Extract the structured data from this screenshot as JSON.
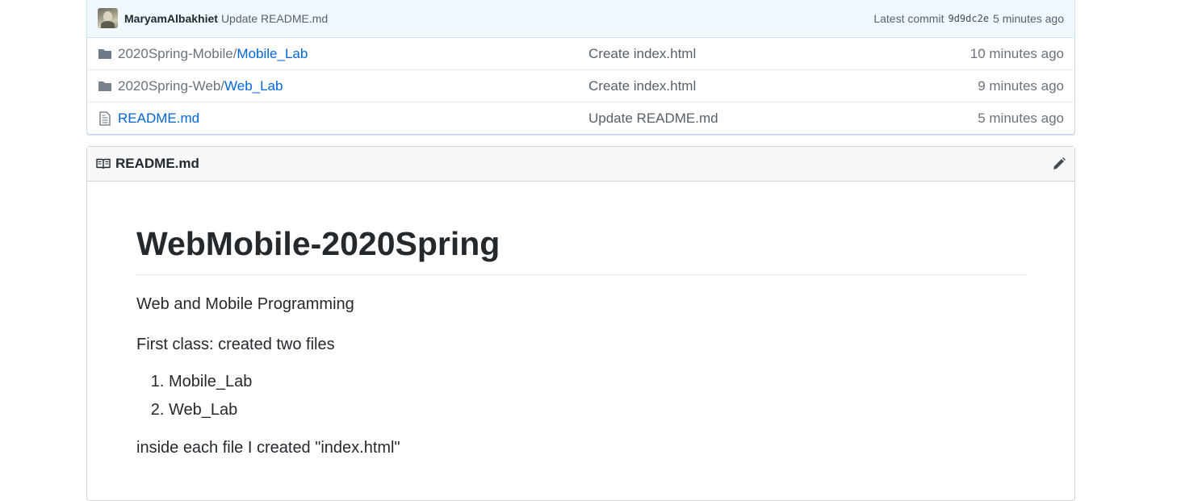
{
  "commit_bar": {
    "author": "MaryamAlbakhiet",
    "message": "Update README.md",
    "latest_label": "Latest commit",
    "sha": "9d9dc2e",
    "age": "5 minutes ago"
  },
  "files": [
    {
      "type": "directory",
      "prefix": "2020Spring-Mobile/",
      "name": "Mobile_Lab",
      "message": "Create index.html",
      "age": "10 minutes ago"
    },
    {
      "type": "directory",
      "prefix": "2020Spring-Web/",
      "name": "Web_Lab",
      "message": "Create index.html",
      "age": "9 minutes ago"
    },
    {
      "type": "file",
      "prefix": "",
      "name": "README.md",
      "message": "Update README.md",
      "age": "5 minutes ago"
    }
  ],
  "readme": {
    "header_title": "README.md",
    "title": "WebMobile-2020Spring",
    "paragraph1": "Web and Mobile Programming",
    "paragraph2": "First class: created two files",
    "list": [
      "Mobile_Lab",
      "Web_Lab"
    ],
    "paragraph3": "inside each file I created \"index.html\""
  },
  "icons": {
    "directory": "folder-icon",
    "file": "file-text-icon",
    "readme": "book-icon",
    "edit": "pencil-icon"
  },
  "colors": {
    "link": "#0366d6",
    "commit_bar_bg": "#f1f8ff",
    "folder_icon": "#79b8ff"
  }
}
